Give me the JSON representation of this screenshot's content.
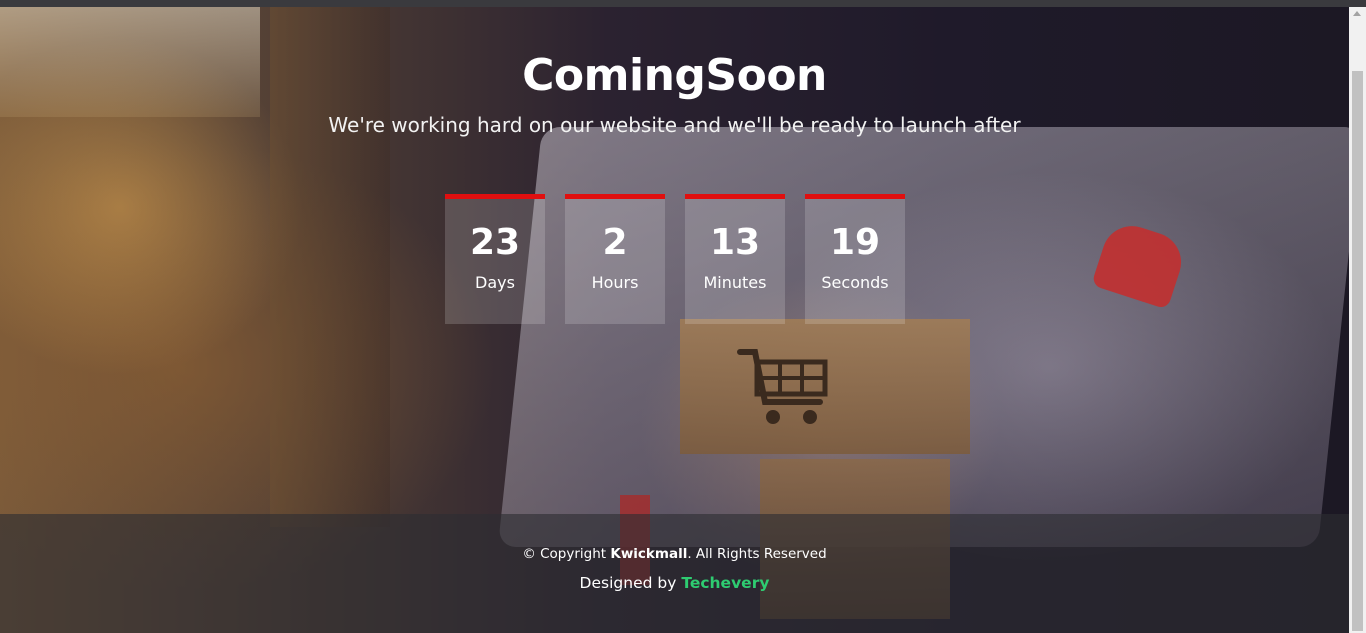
{
  "hero": {
    "title": "ComingSoon",
    "subtitle": "We're working hard on our website and we'll be ready to launch after"
  },
  "countdown": [
    {
      "value": "23",
      "label": "Days"
    },
    {
      "value": "2",
      "label": "Hours"
    },
    {
      "value": "13",
      "label": "Minutes"
    },
    {
      "value": "19",
      "label": "Seconds"
    }
  ],
  "footer": {
    "copyright_prefix": "© Copyright ",
    "company": "Kwickmall",
    "copyright_suffix": ". All Rights Reserved",
    "designed_prefix": "Designed by ",
    "designer": "Techevery"
  },
  "colors": {
    "accent": "#e00f0f",
    "designer_link": "#2ecc71"
  },
  "icons": {
    "scroll_up": "scroll-up-arrow-icon"
  }
}
